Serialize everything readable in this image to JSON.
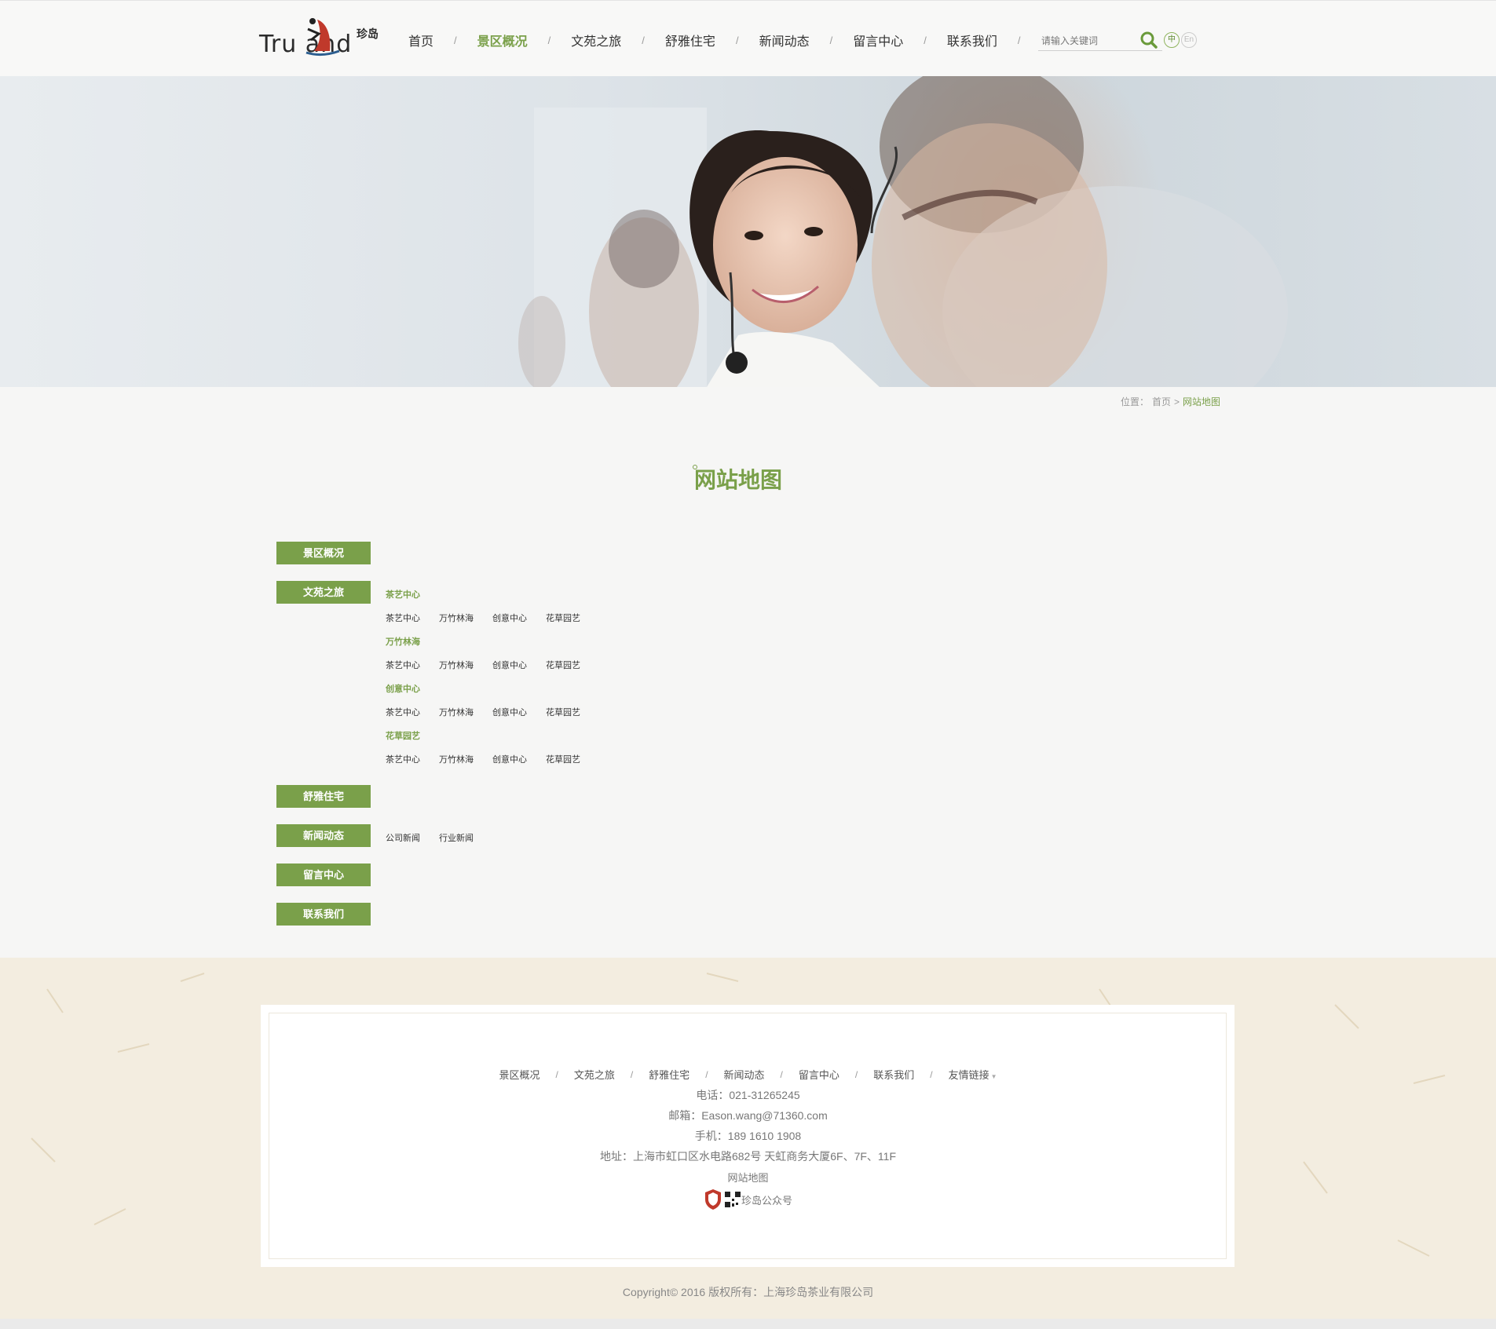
{
  "header": {
    "logo_text": "Tru  and",
    "logo_cn": "珍岛",
    "nav": [
      {
        "label": "首页",
        "active": false
      },
      {
        "label": "景区概况",
        "active": true
      },
      {
        "label": "文苑之旅",
        "active": false
      },
      {
        "label": "舒雅住宅",
        "active": false
      },
      {
        "label": "新闻动态",
        "active": false
      },
      {
        "label": "留言中心",
        "active": false
      },
      {
        "label": "联系我们",
        "active": false
      }
    ],
    "nav_separator": "/",
    "search_placeholder": "请输入关键词",
    "lang_zh": "中",
    "lang_en": "En"
  },
  "breadcrumb": {
    "prefix": "位置：",
    "home": "首页",
    "sep": ">",
    "current": "网站地图"
  },
  "page_title": "网站地图",
  "sitemap": {
    "sections": [
      {
        "label": "景区概况",
        "children": []
      },
      {
        "label": "文苑之旅",
        "groups": [
          {
            "title": "茶艺中心",
            "items": [
              "茶艺中心",
              "万竹林海",
              "创意中心",
              "花草园艺"
            ]
          },
          {
            "title": "万竹林海",
            "items": [
              "茶艺中心",
              "万竹林海",
              "创意中心",
              "花草园艺"
            ]
          },
          {
            "title": "创意中心",
            "items": [
              "茶艺中心",
              "万竹林海",
              "创意中心",
              "花草园艺"
            ]
          },
          {
            "title": "花草园艺",
            "items": [
              "茶艺中心",
              "万竹林海",
              "创意中心",
              "花草园艺"
            ]
          }
        ]
      },
      {
        "label": "舒雅住宅",
        "children": []
      },
      {
        "label": "新闻动态",
        "children": [
          "公司新闻",
          "行业新闻"
        ]
      },
      {
        "label": "留言中心",
        "children": []
      },
      {
        "label": "联系我们",
        "children": []
      }
    ]
  },
  "footer": {
    "nav": [
      "景区概况",
      "文苑之旅",
      "舒雅住宅",
      "新闻动态",
      "留言中心",
      "联系我们",
      "友情链接"
    ],
    "separator": "/",
    "phone": "电话：021-31265245",
    "email": "邮箱：Eason.wang@71360.com",
    "mobile": "手机：189 1610 1908",
    "address": "地址：上海市虹口区水电路682号 天虹商务大厦6F、7F、11F",
    "sitemap_link": "网站地图",
    "wechat_label": "珍岛公众号",
    "copyright": "Copyright© 2016 版权所有：上海珍岛茶业有限公司"
  },
  "colors": {
    "accent": "#7aa04a",
    "footer_bg": "#f3ede0"
  }
}
